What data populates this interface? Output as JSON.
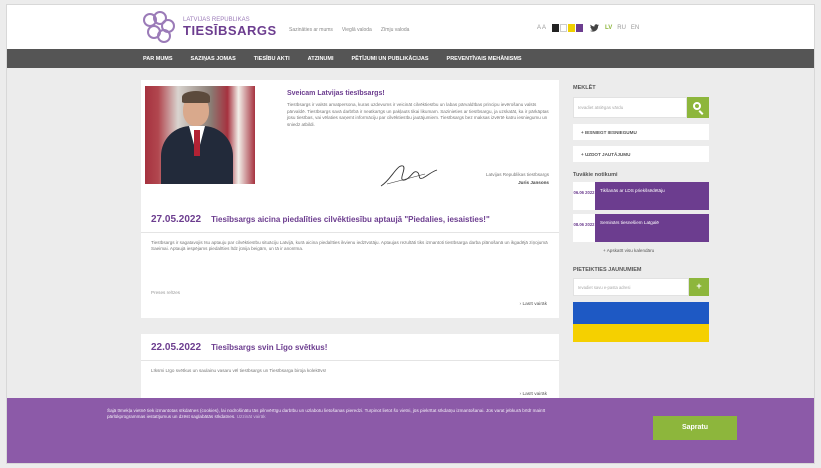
{
  "header": {
    "logo_top": "LATVIJAS REPUBLIKAS",
    "logo_main": "TIESĪBSARGS",
    "top_links": [
      "Sazināties ar mums",
      "Vieglā valoda",
      "Zīmju valoda"
    ],
    "font_size": "A A",
    "contrast_colors": [
      "#222222",
      "#ffffff",
      "#f0d000",
      "#6c3d8f"
    ],
    "twitter_icon": "twitter-icon",
    "languages": [
      "LV",
      "RU",
      "EN"
    ],
    "active_language": "LV"
  },
  "nav": {
    "items": [
      "PAR MUMS",
      "SAZIŅAS JOMAS",
      "TIESĪBU AKTI",
      "ATZINUMI",
      "PĒTĪJUMI UN PUBLIKĀCIJAS",
      "PREVENTĪVAIS MEHĀNISMS"
    ]
  },
  "feature": {
    "title": "Sveicam Latvijas tiesībsargs!",
    "text": "Tiesībsargs ir valsts amatpersona, kuras uzdevums ir veicināt cilvēktiesību un labas pārvaldības principu ievērošanu valsts pārvaldē. Tiesībsargs savā darbībā ir neatkarīgs un pakļauts tikai likumam. Sazinieties ar tiesībsargu, ja uzskatāt, ka ir pārkāptas jūsu tiesības, vai vēlaties saņemt informāciju par cilvēktiesību jautājumiem. Tiesībsargs bez maksas izvērtē katru iesniegumu un sniedz atbildi.",
    "sign_role": "Latvijas Republikas tiesībsargs",
    "sign_name": "Juris Jansons"
  },
  "news": [
    {
      "date": "27.05.2022",
      "title": "Tiesībsargs aicina piedalīties cilvēktiesību aptaujā \"Piedalies, iesaisties!\"",
      "text": "Tiesībsargs ir sagatavojis īsu aptauju par cilvēktiesību situāciju Latvijā, kurā aicina piedalīties ikvienu iedzīvotāju. Aptaujas rezultāti tiks izmantoti tiesībsarga darba plānošanā un ikgadējā ziņojumā Saeimai. Aptaujā iespējams piedalīties līdz jūnija beigām, un tā ir anonīma.",
      "tag": "Preses relīzes",
      "more": "› Lasīt vairāk"
    },
    {
      "date": "22.05.2022",
      "title": "Tiesībsargs svin Līgo svētkus!",
      "text": "Līksmi Līgo svētkus un saulainu vasaru vēl tiesībsargs un Tiesībsarga biroja kolektīvs!",
      "more": "› Lasīt vairāk"
    }
  ],
  "sidebar": {
    "search_title": "MEKLĒT",
    "search_placeholder": "Ievadiet atslēgas vārdu",
    "links": [
      "+ IESNIEGT IESNIEGUMU",
      "+ UZDOT JAUTĀJUMU"
    ],
    "events_title": "Tuvākie notikumi",
    "events": [
      {
        "date": "06.06 2022",
        "title": "Tikšanās ar LDS priekšsēdētāju"
      },
      {
        "date": "08.06 2022",
        "title": "Seminārs tiesnešiem Latgalē"
      }
    ],
    "events_more": "+ Apskatīt visu kalendāru",
    "subscribe_title": "PIETEIKTIES JAUNUMIEM",
    "subscribe_placeholder": "Ievadiet savu e-pasta adresi",
    "subscribe_button": "+"
  },
  "cookie": {
    "text": "Šajā tīmekļa vietnē tiek izmantotas sīkdatnes (cookies), lai nodrošinātu tās pilnvērtīgu darbību un uzlabotu lietošanas pieredzi. Turpinot lietot šo vietni, jūs piekrītat sīkdatņu izmantošanai. Jūs varat jebkurā brīdī mainīt pārlūkprogrammas iestatījumus un dzēst saglabātās sīkdatnes.",
    "more": "Uzzināt vairāk",
    "button": "Sapratu"
  }
}
